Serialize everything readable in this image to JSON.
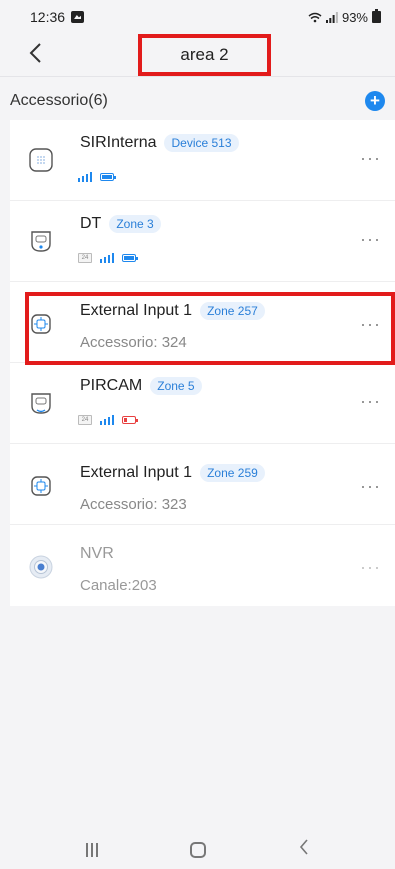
{
  "status_bar": {
    "time": "12:36",
    "battery": "93%"
  },
  "header": {
    "back": "<",
    "title": "area 2"
  },
  "section": {
    "title": "Accessorio(6)",
    "add": "+"
  },
  "items": [
    {
      "name": "SIRInterna",
      "badge": "Device 513",
      "sub": "",
      "indicators": {
        "temp": false,
        "signal": true,
        "battery": "full"
      },
      "icon": "siren-icon",
      "more": "···"
    },
    {
      "name": "DT",
      "badge": "Zone 3",
      "sub": "",
      "indicators": {
        "temp": true,
        "temp_label": "24",
        "signal": true,
        "battery": "full"
      },
      "icon": "motion-detector-icon",
      "more": "···"
    },
    {
      "name": "External Input 1",
      "badge": "Zone 257",
      "sub": "Accessorio: 324",
      "icon": "external-input-icon",
      "more": "···"
    },
    {
      "name": "PIRCAM",
      "badge": "Zone 5",
      "sub": "",
      "indicators": {
        "temp": true,
        "temp_label": "24",
        "signal": true,
        "battery": "low"
      },
      "icon": "pir-camera-icon",
      "more": "···"
    },
    {
      "name": "External Input 1",
      "badge": "Zone 259",
      "sub": "Accessorio: 323",
      "icon": "external-input-icon",
      "more": "···"
    },
    {
      "name": "NVR",
      "badge": "",
      "sub": "Canale:203",
      "icon": "nvr-camera-icon",
      "more": "···"
    }
  ],
  "colors": {
    "accent": "#1e88ee",
    "highlight": "#e21b1b",
    "battery_low": "#e84040"
  }
}
